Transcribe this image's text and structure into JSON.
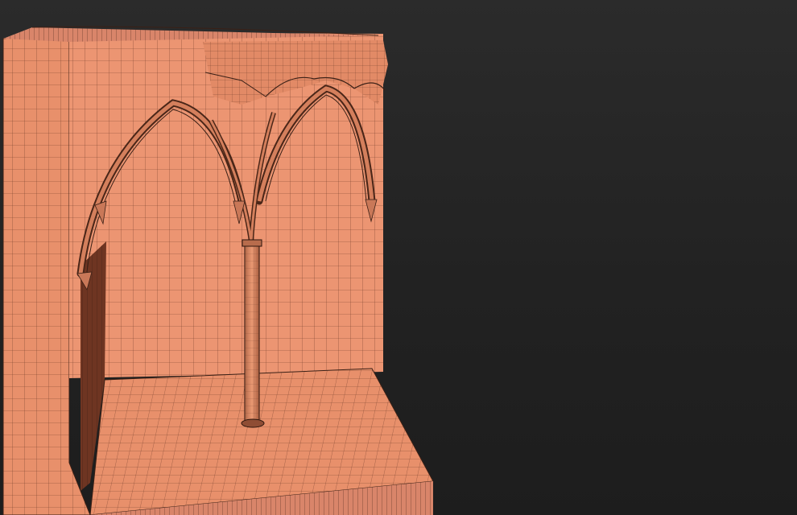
{
  "viewport": {
    "label": "",
    "background_top": "#2b2b2b",
    "background_bottom": "#1d1d1d"
  },
  "model": {
    "name": "",
    "surface_color": "#e8906b",
    "surface_shade": "#c97858",
    "surface_dark": "#8f4d34",
    "wire_color": "#3a2016"
  }
}
